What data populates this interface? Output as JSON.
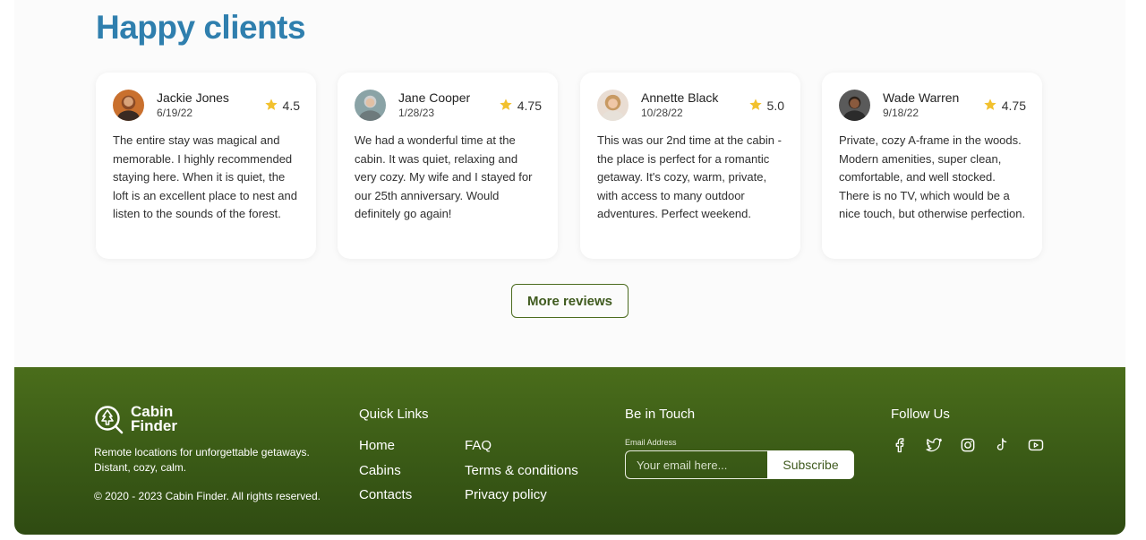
{
  "section": {
    "title": "Happy clients"
  },
  "reviews": [
    {
      "name": "Jackie Jones",
      "date": "6/19/22",
      "rating": "4.5",
      "text": "The entire stay was magical and memorable. I highly recommended staying here. When it is quiet, the loft is an excellent place to nest and listen to the sounds of the forest."
    },
    {
      "name": "Jane Cooper",
      "date": "1/28/23",
      "rating": "4.75",
      "text": "We had a wonderful time at the cabin. It was quiet, relaxing and very cozy. My wife and I stayed for our 25th anniversary. Would definitely go again!"
    },
    {
      "name": "Annette Black",
      "date": "10/28/22",
      "rating": "5.0",
      "text": "This was our 2nd time at the cabin - the place is perfect for a romantic getaway. It's cozy, warm, private, with access to many outdoor adventures. Perfect weekend."
    },
    {
      "name": "Wade Warren",
      "date": "9/18/22",
      "rating": "4.75",
      "text": "Private, cozy A-frame in the woods. Modern amenities, super clean, comfortable, and well stocked. There is no TV, which would be a nice touch, but otherwise perfection."
    }
  ],
  "more_reviews_label": "More reviews",
  "footer": {
    "brand_line1": "Cabin",
    "brand_line2": "Finder",
    "tagline": "Remote locations for unforgettable getaways. Distant, cozy, calm.",
    "copyright": "© 2020 - 2023 Cabin Finder. All rights reserved.",
    "quick_links_title": "Quick Links",
    "links": [
      "Home",
      "Cabins",
      "Contacts",
      "FAQ",
      "Terms & conditions",
      "Privacy policy"
    ],
    "touch_title": "Be in Touch",
    "email_label": "Email Address",
    "email_placeholder": "Your email here...",
    "email_value": "",
    "subscribe_label": "Subscribe",
    "follow_title": "Follow Us",
    "social_icons": [
      "facebook-icon",
      "twitter-icon",
      "instagram-icon",
      "tiktok-icon",
      "youtube-icon"
    ]
  },
  "colors": {
    "title": "#2f7fae",
    "footer_bg": "#3f6118",
    "star": "#f2c12e",
    "button_border": "#4b6b1e"
  }
}
